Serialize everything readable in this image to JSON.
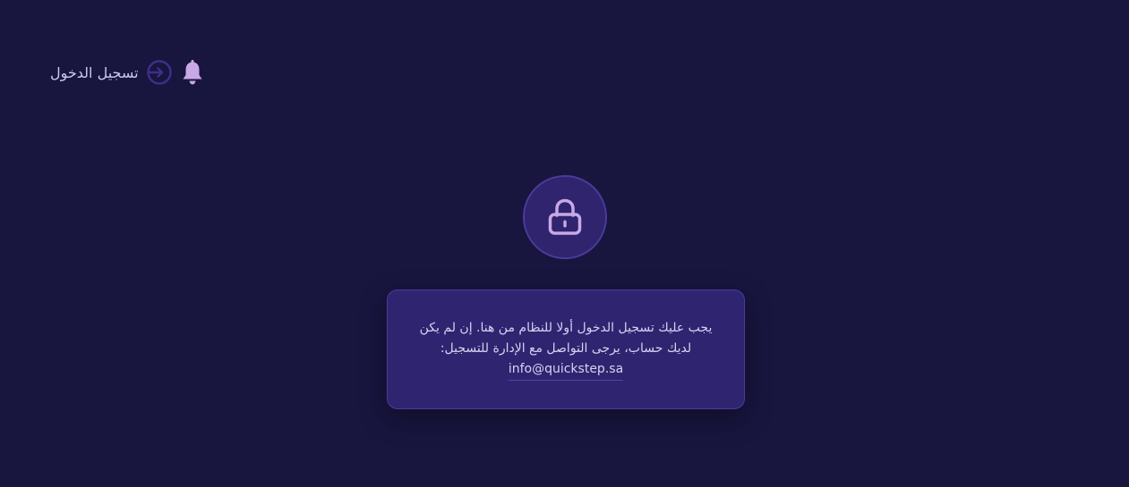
{
  "header": {
    "login_label": "تسجيل الدخول",
    "login_icon": "sign-in-icon",
    "notification_icon": "bell-icon"
  },
  "lock": {
    "icon": "lock-icon"
  },
  "message": {
    "line1": "يجب عليك تسجيل الدخول أولا للنظام من هنا. إن لم يكن",
    "line2": "لديك حساب، يرجى التواصل مع الإدارة للتسجيل:",
    "email": "info@quickstep.sa"
  },
  "colors": {
    "background": "#18153f",
    "card": "#2e2470",
    "accent": "#4a3b9a",
    "icon": "#c9a8e8"
  }
}
